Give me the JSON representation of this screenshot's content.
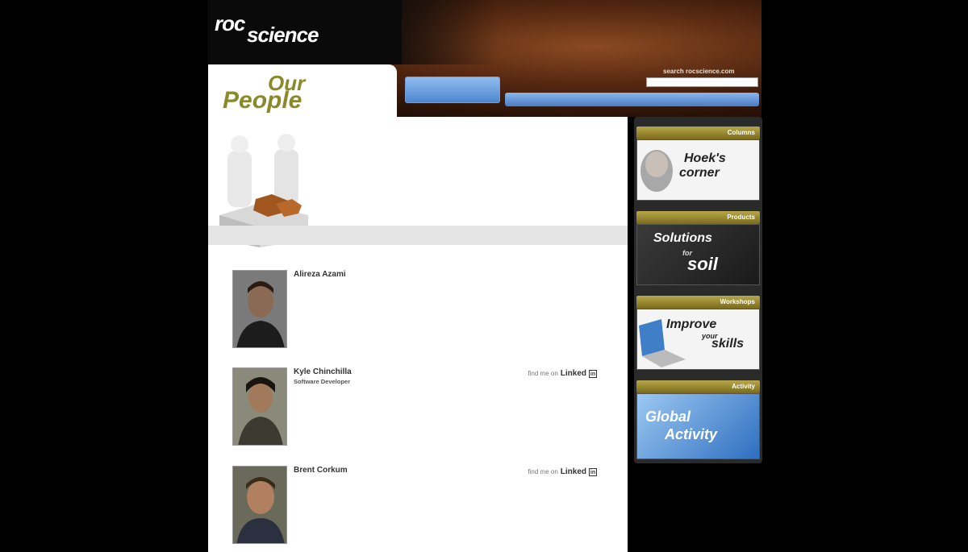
{
  "header": {
    "logo_roc": "roc",
    "logo_science": "science",
    "logo_tagline": "",
    "top_links": [
      "",
      "",
      ""
    ],
    "search_label": "search rocscience.com",
    "search_placeholder": "",
    "promo": {
      "line1": "",
      "line2": "",
      "line3": ""
    },
    "nav": [
      "",
      "",
      "",
      "",
      ""
    ]
  },
  "page_title": {
    "our": "Our",
    "people": "People",
    "sub1": "",
    "sub2": ""
  },
  "intro": {
    "text": "",
    "email": ""
  },
  "people": [
    {
      "name": "Alireza Azami",
      "role": "",
      "bio": "",
      "linkedin_prefix": "",
      "linkedin": ""
    },
    {
      "name": "Kyle Chinchilla",
      "role": "Software Developer",
      "bio": "",
      "linkedin_prefix": "find me on",
      "linkedin": "Linked"
    },
    {
      "name": "Brent Corkum",
      "role": "",
      "bio": "",
      "linkedin_prefix": "find me on",
      "linkedin": "Linked"
    }
  ],
  "sidebar": [
    {
      "bar": "Columns",
      "line1": "Hoek's",
      "line2": "corner",
      "line3": ""
    },
    {
      "bar": "Products",
      "line1": "Solutions",
      "line2": "soil",
      "line3": "for"
    },
    {
      "bar": "Workshops",
      "line1": "Improve",
      "line2": "skills",
      "line3": "your"
    },
    {
      "bar": "Activity",
      "line1": "Global",
      "line2": "Activity",
      "line3": ""
    }
  ]
}
